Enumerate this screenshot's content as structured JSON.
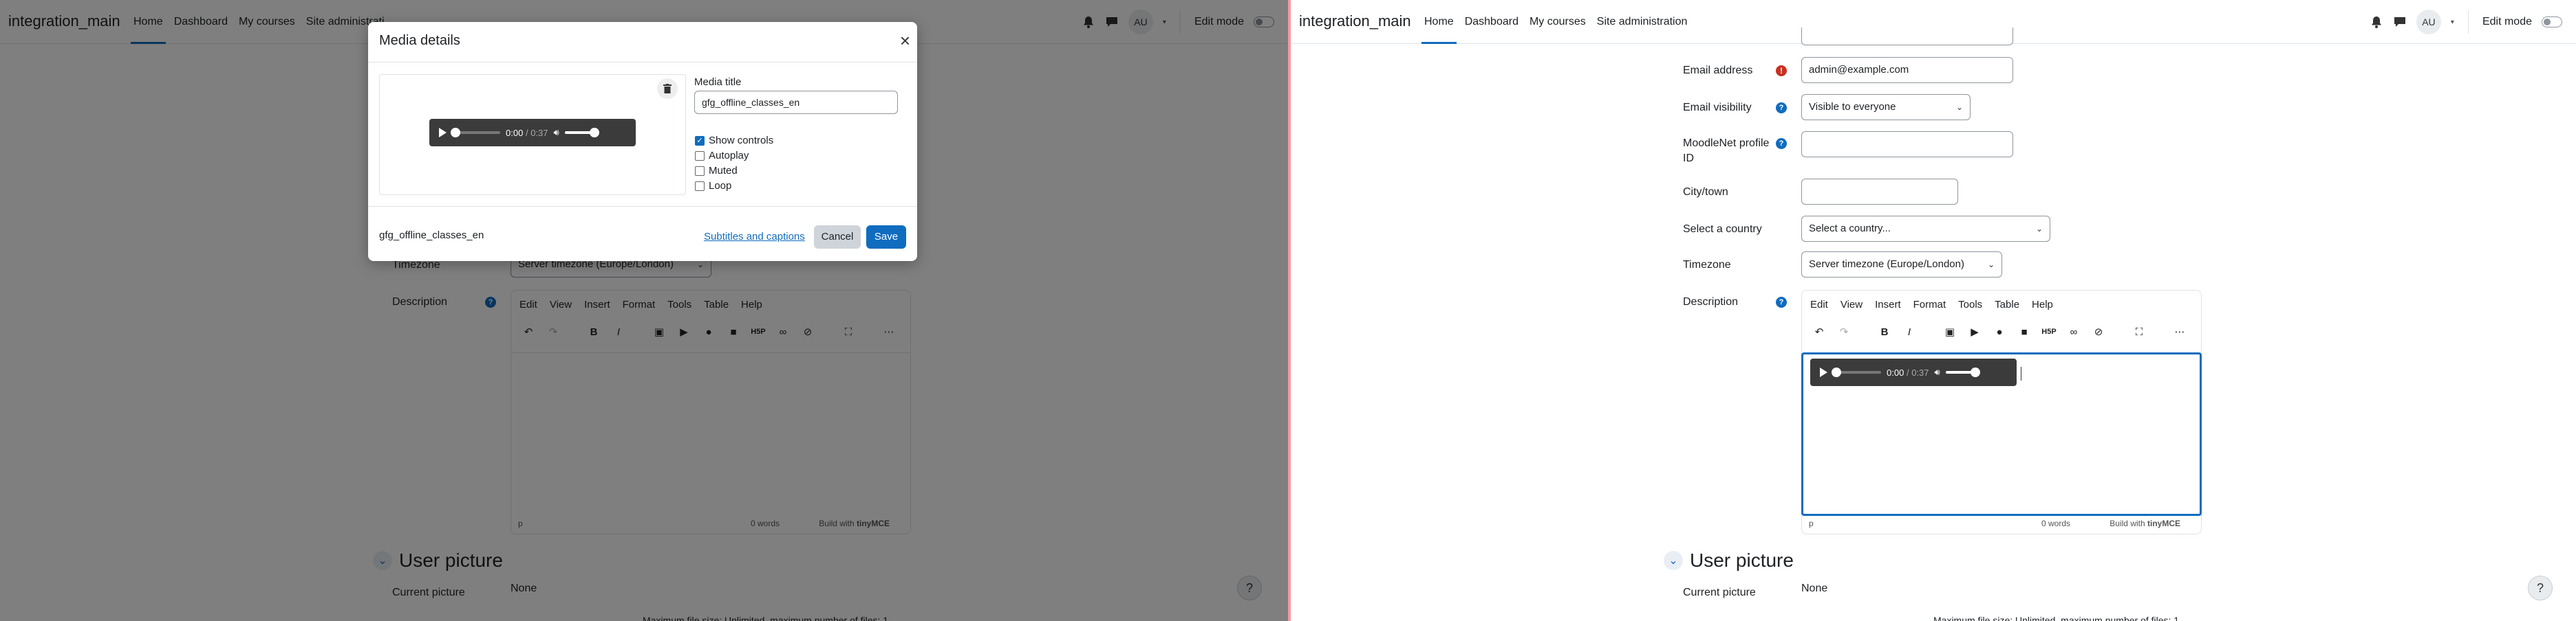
{
  "navbar": {
    "brand": "integration_main",
    "items": [
      {
        "label": "Home",
        "active": true
      },
      {
        "label": "Dashboard",
        "active": false
      },
      {
        "label": "My courses",
        "active": false
      },
      {
        "label": "Site administration",
        "active": false
      }
    ],
    "left_last_item": "Site administrati",
    "avatar": "AU",
    "edit_mode": "Edit mode"
  },
  "form": {
    "email_label": "Email address",
    "email_value": "admin@example.com",
    "email_visibility_label": "Email visibility",
    "email_visibility_value": "Visible to everyone",
    "moodlenet_label_line1": "MoodleNet profile",
    "moodlenet_label_line2": "ID",
    "city_label": "City/town",
    "country_label": "Select a country",
    "country_value": "Select a country...",
    "timezone_label": "Timezone",
    "timezone_value": "Server timezone (Europe/London)",
    "description_label": "Description"
  },
  "editor": {
    "menus": [
      "Edit",
      "View",
      "Insert",
      "Format",
      "Tools",
      "Table",
      "Help"
    ],
    "path": "p",
    "words": "0 words",
    "build_with": "Build with",
    "tinymce": "tinyMCE"
  },
  "audio": {
    "current": "0:00",
    "separator": "/",
    "duration": "0:37"
  },
  "user_picture": {
    "heading": "User picture",
    "current_label": "Current picture",
    "current_value": "None",
    "max_file_size": "Maximum file size: Unlimited, maximum number of files: 1"
  },
  "modal": {
    "title": "Media details",
    "media_title_label": "Media title",
    "media_title_value": "gfg_offline_classes_en",
    "options": [
      {
        "label": "Show controls",
        "checked": true
      },
      {
        "label": "Autoplay",
        "checked": false
      },
      {
        "label": "Muted",
        "checked": false
      },
      {
        "label": "Loop",
        "checked": false
      }
    ],
    "filename": "gfg_offline_classes_en",
    "subtitles_link": "Subtitles and captions",
    "cancel": "Cancel",
    "save": "Save"
  },
  "help_button": "?",
  "colors": {
    "primary": "#0f6cbf",
    "required": "#ca3120",
    "overlay": "rgba(0,0,0,0.5)"
  }
}
